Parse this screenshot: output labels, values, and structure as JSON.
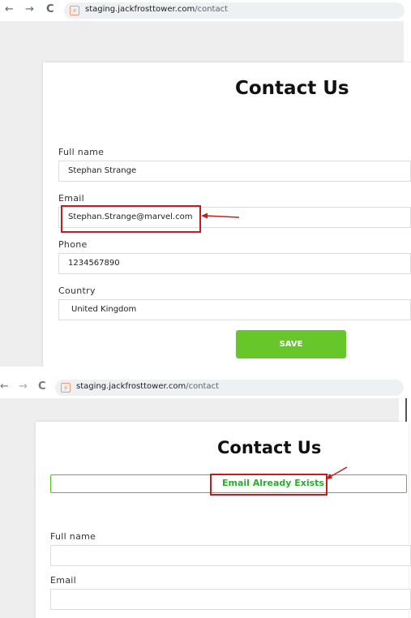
{
  "browser": {
    "back_icon": "←",
    "forward_icon": "→",
    "reload_icon": "C",
    "url_domain": "staging.jackfrosttower.com",
    "url_path": "/contact"
  },
  "form_before": {
    "title": "Contact Us",
    "fullname_label": "Full name",
    "fullname_value": "Stephan Strange",
    "email_label": "Email",
    "email_value": "Stephan.Strange@marvel.com",
    "phone_label": "Phone",
    "phone_value": "1234567890",
    "country_label": "Country",
    "country_value": "United Kingdom",
    "save_label": "SAVE"
  },
  "form_after": {
    "title": "Contact Us",
    "alert_message": "Email Already Exists",
    "fullname_label": "Full name",
    "fullname_value": "",
    "email_label": "Email",
    "email_value": ""
  },
  "colors": {
    "save_button": "#66c62a",
    "alert_text": "#23b12a",
    "annotation_red": "#c11f1f"
  }
}
